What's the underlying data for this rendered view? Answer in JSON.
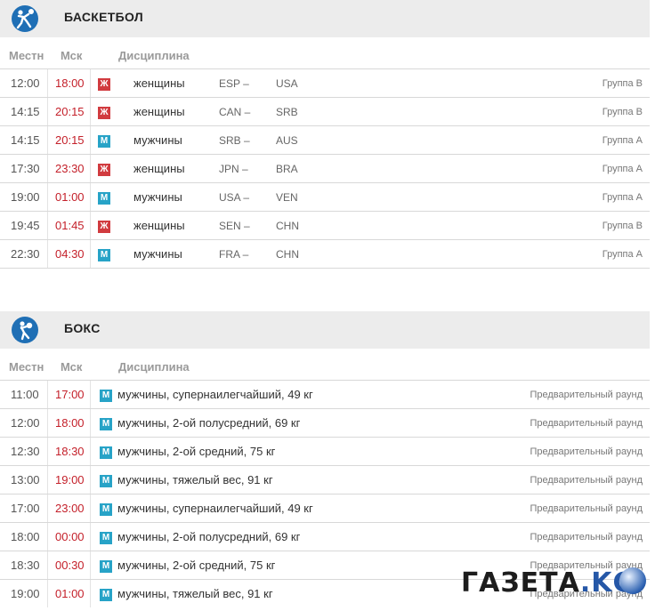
{
  "sections": [
    {
      "title": "БАСКЕТБОЛ",
      "icon": "basketball-icon",
      "columns": {
        "local": "Местн",
        "msk": "Мск",
        "discipline": "Дисциплина"
      },
      "rows": [
        {
          "local": "12:00",
          "msk": "18:00",
          "gender": "Ж",
          "gender_type": "w",
          "discipline": "женщины",
          "team1": "ESP –",
          "team2": "USA",
          "stage": "Группа B"
        },
        {
          "local": "14:15",
          "msk": "20:15",
          "gender": "Ж",
          "gender_type": "w",
          "discipline": "женщины",
          "team1": "CAN –",
          "team2": "SRB",
          "stage": "Группа B"
        },
        {
          "local": "14:15",
          "msk": "20:15",
          "gender": "М",
          "gender_type": "m",
          "discipline": "мужчины",
          "team1": "SRB –",
          "team2": "AUS",
          "stage": "Группа A"
        },
        {
          "local": "17:30",
          "msk": "23:30",
          "gender": "Ж",
          "gender_type": "w",
          "discipline": "женщины",
          "team1": "JPN –",
          "team2": "BRA",
          "stage": "Группа A"
        },
        {
          "local": "19:00",
          "msk": "01:00",
          "gender": "М",
          "gender_type": "m",
          "discipline": "мужчины",
          "team1": "USA –",
          "team2": "VEN",
          "stage": "Группа A"
        },
        {
          "local": "19:45",
          "msk": "01:45",
          "gender": "Ж",
          "gender_type": "w",
          "discipline": "женщины",
          "team1": "SEN –",
          "team2": "CHN",
          "stage": "Группа B"
        },
        {
          "local": "22:30",
          "msk": "04:30",
          "gender": "М",
          "gender_type": "m",
          "discipline": "мужчины",
          "team1": "FRA –",
          "team2": "CHN",
          "stage": "Группа A"
        }
      ]
    },
    {
      "title": "БОКС",
      "icon": "boxing-icon",
      "columns": {
        "local": "Местн",
        "msk": "Мск",
        "discipline": "Дисциплина"
      },
      "rows": [
        {
          "local": "11:00",
          "msk": "17:00",
          "gender": "М",
          "event": "мужчины, супернаилегчайший, 49 кг",
          "stage": "Предварительный раунд"
        },
        {
          "local": "12:00",
          "msk": "18:00",
          "gender": "М",
          "event": "мужчины, 2-ой полусредний, 69 кг",
          "stage": "Предварительный раунд"
        },
        {
          "local": "12:30",
          "msk": "18:30",
          "gender": "М",
          "event": "мужчины, 2-ой средний, 75 кг",
          "stage": "Предварительный раунд"
        },
        {
          "local": "13:00",
          "msk": "19:00",
          "gender": "М",
          "event": "мужчины, тяжелый вес, 91 кг",
          "stage": "Предварительный раунд"
        },
        {
          "local": "17:00",
          "msk": "23:00",
          "gender": "М",
          "event": "мужчины, супернаилегчайший, 49 кг",
          "stage": "Предварительный раунд"
        },
        {
          "local": "18:00",
          "msk": "00:00",
          "gender": "М",
          "event": "мужчины, 2-ой полусредний, 69 кг",
          "stage": "Предварительный раунд"
        },
        {
          "local": "18:30",
          "msk": "00:30",
          "gender": "М",
          "event": "мужчины, 2-ой средний, 75 кг",
          "stage": "Предварительный раунд"
        },
        {
          "local": "19:00",
          "msk": "01:00",
          "gender": "М",
          "event": "мужчины, тяжелый вес, 91 кг",
          "stage": "Предварительный раунд"
        }
      ]
    }
  ],
  "watermark": {
    "text": "ГАЗЕТА",
    "suffix": ".KG"
  },
  "colors": {
    "women_badge": "#d13b3f",
    "men_badge": "#27a3c7",
    "msk_time": "#c4202a",
    "header_bg": "#ececec"
  }
}
